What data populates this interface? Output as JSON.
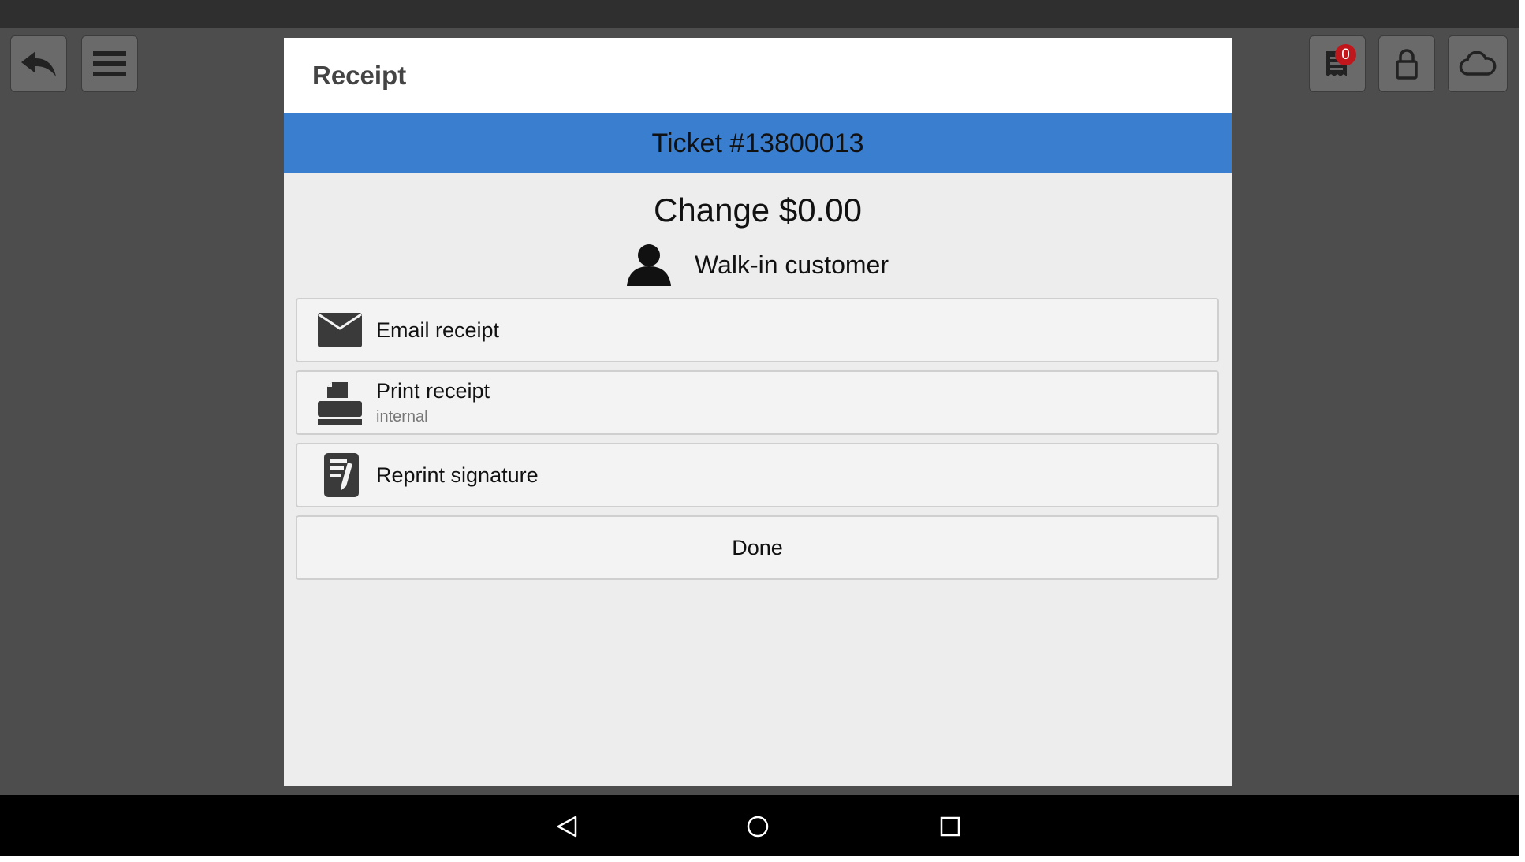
{
  "toolbar": {
    "back_icon": "back-arrow-icon",
    "menu_icon": "hamburger-menu-icon",
    "tickets_icon": "receipt-icon",
    "tickets_badge": "0",
    "lock_icon": "lock-icon",
    "cloud_icon": "cloud-icon",
    "badge_color": "#c0171d"
  },
  "dialog": {
    "title": "Receipt",
    "ticket": "Ticket #13800013",
    "ticket_bar_color": "#3a7ecf",
    "change": "Change $0.00",
    "customer": "Walk-in customer",
    "actions": [
      {
        "label": "Email receipt",
        "icon": "envelope-icon"
      },
      {
        "label": "Print receipt",
        "sublabel": "internal",
        "icon": "printer-icon"
      },
      {
        "label": "Reprint signature",
        "icon": "signature-document-icon"
      }
    ],
    "done": "Done"
  },
  "system_nav": {
    "back": "triangle-back-icon",
    "home": "circle-home-icon",
    "recents": "square-recents-icon"
  }
}
